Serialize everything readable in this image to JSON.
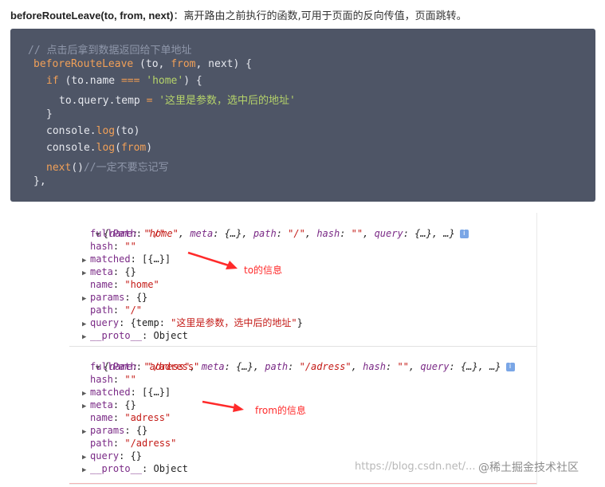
{
  "heading": {
    "signature": "beforeRouteLeave(to, from, next)",
    "colon": "：",
    "description": "离开路由之前执行的函数,可用于页面的反向传值，页面跳转。"
  },
  "code": {
    "comment": "// 点击后拿到数据返回给下单地址",
    "fn_name": "beforeRouteLeave",
    "fn_args_open": " (",
    "arg_to": "to",
    "comma1": ", ",
    "arg_from": "from",
    "comma2": ", ",
    "arg_next": "next",
    "fn_args_close": ") {",
    "if_kw": "if",
    "if_cond_a": " (to.name ",
    "eq_op": "===",
    "if_space": " ",
    "if_str": "'home'",
    "if_close": ") {",
    "assign_lhs": "to.query.temp ",
    "assign_op": "=",
    "assign_space": " ",
    "assign_str": "'这里是参数，选中后的地址'",
    "close_if": "}",
    "log1_obj": "console.",
    "log1_fn": "log",
    "log1_args": "(to)",
    "log2_obj": "console.",
    "log2_fn": "log",
    "log2_open": "(",
    "log2_arg": "from",
    "log2_close": ")",
    "next_fn": "next",
    "next_call": "()",
    "next_comment": "//一定不要忘记写",
    "end": "},"
  },
  "console_to": {
    "summary_open": "{",
    "k_name": "name",
    "v_name": "\"home\"",
    "k_meta": "meta",
    "v_meta": "{…}",
    "k_path": "path",
    "v_path": "\"/\"",
    "k_hash": "hash",
    "v_hash": "\"\"",
    "k_query": "query",
    "v_query": "{…}",
    "summary_tail": ", …}",
    "info": "i",
    "props": [
      {
        "key": "fullPath",
        "value": "\"/\"",
        "str": true
      },
      {
        "key": "hash",
        "value": "\"\"",
        "str": true
      },
      {
        "key": "matched",
        "value": "[{…}]",
        "str": false
      },
      {
        "key": "meta",
        "value": "{}",
        "str": false
      },
      {
        "key": "name",
        "value": "\"home\"",
        "str": true
      },
      {
        "key": "params",
        "value": "{}",
        "str": false
      },
      {
        "key": "path",
        "value": "\"/\"",
        "str": true
      },
      {
        "key": "query",
        "value_prefix": "{temp: ",
        "value_str": "\"这里是参数，选中后的地址\"",
        "value_suffix": "}"
      },
      {
        "key": "__proto__",
        "value": "Object",
        "str": false
      }
    ]
  },
  "console_from": {
    "summary_open": "{",
    "k_name": "name",
    "v_name": "\"adress\"",
    "k_meta": "meta",
    "v_meta": "{…}",
    "k_path": "path",
    "v_path": "\"/adress\"",
    "k_hash": "hash",
    "v_hash": "\"\"",
    "k_query": "query",
    "v_query": "{…}",
    "summary_tail": ", …}",
    "info": "i",
    "props": [
      {
        "key": "fullPath",
        "value": "\"/adress\"",
        "str": true
      },
      {
        "key": "hash",
        "value": "\"\"",
        "str": true
      },
      {
        "key": "matched",
        "value": "[{…}]",
        "str": false
      },
      {
        "key": "meta",
        "value": "{}",
        "str": false
      },
      {
        "key": "name",
        "value": "\"adress\"",
        "str": true
      },
      {
        "key": "params",
        "value": "{}",
        "str": false
      },
      {
        "key": "path",
        "value": "\"/adress\"",
        "str": true
      },
      {
        "key": "query",
        "value": "{}",
        "str": false
      },
      {
        "key": "__proto__",
        "value": "Object",
        "str": false
      }
    ]
  },
  "annotations": {
    "to_label": "to的信息",
    "from_label": "from的信息"
  },
  "watermark": {
    "url": "https://blog.csdn.net/...",
    "brand": "@稀土掘金技术社区"
  },
  "colors": {
    "code_bg": "#4e5566",
    "annotation_red": "#ff2a2a",
    "console_key": "#7a2a86",
    "console_string": "#c41a16"
  }
}
